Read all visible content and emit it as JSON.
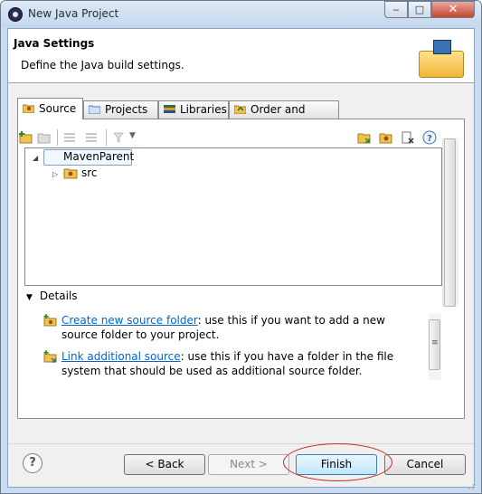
{
  "window": {
    "title": "New Java Project"
  },
  "header": {
    "title": "Java Settings",
    "subtitle": "Define the Java build settings."
  },
  "tabs": [
    {
      "label": "Source",
      "active": true,
      "icon": "source-folder-icon"
    },
    {
      "label": "Projects",
      "active": false,
      "icon": "project-folder-icon"
    },
    {
      "label": "Libraries",
      "active": false,
      "icon": "library-books-icon"
    },
    {
      "label": "Order and Export",
      "active": false,
      "icon": "order-export-icon"
    }
  ],
  "tree": {
    "project": "MavenParent",
    "children": [
      "src"
    ]
  },
  "details": {
    "label": "Details",
    "items": [
      {
        "link": "Create new source folder",
        "text": ": use this if you want to add a new source folder to your project."
      },
      {
        "link": "Link additional source",
        "text": ": use this if you have a folder in the file system that should be used as additional source folder."
      }
    ]
  },
  "buttons": {
    "back": "< Back",
    "next": "Next >",
    "finish": "Finish",
    "cancel": "Cancel"
  },
  "colors": {
    "accent": "#3c7fb1",
    "link": "#0066cc",
    "highlight": "#c8281e"
  }
}
